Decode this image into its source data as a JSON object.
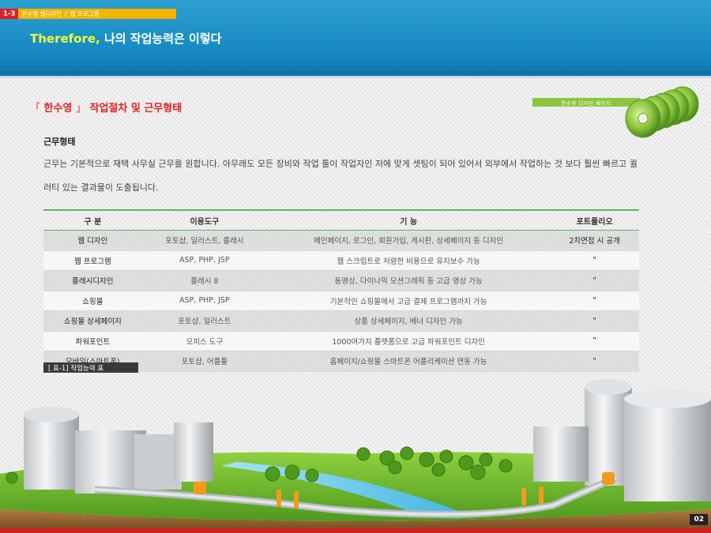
{
  "breadcrumb": {
    "section_no": "1-3",
    "items": [
      "한수영 웹디자인",
      "웹 프로그램"
    ],
    "separator": "/"
  },
  "header": {
    "lead": "Therefore,",
    "title": " 나의 작업능력은 이렇다"
  },
  "section": {
    "open_quote": "「",
    "name": " 한수영 ",
    "close_quote": "」",
    "title": " 작업절차 및 근무형태"
  },
  "badge": {
    "label": "한수영 디자인 페이지"
  },
  "work_type": {
    "heading": "근무형태",
    "body": "근무는 기본적으로 재택 사무실 근무를 원합니다. 아무래도 모든 장비와 작업 툴이 작업자인 저에 맞게 셋팅이 되어 있어서 외부에서 작업하는 것 보다 훨씬 빠르고 퀄러티 있는 결과물이 도출됩니다."
  },
  "table": {
    "headers": [
      "구  분",
      "이용도구",
      "기  능",
      "포트폴리오"
    ],
    "rows": [
      [
        "웹 디자인",
        "포토샵, 일러스트, 플래시",
        "메인페이지, 로그인, 회원가입, 게시판, 상세페이지 등 디자인",
        "2차면접 시 공개"
      ],
      [
        "웹 프로그램",
        "ASP, PHP, JSP",
        "웹 스크립트로 저렴한 비용으로 유지보수 가능",
        "\""
      ],
      [
        "플래시디자인",
        "플래시 8",
        "동영상, 다이나믹 모션그래픽 등 고급 영상 가능",
        "\""
      ],
      [
        "쇼핑몰",
        "ASP, PHP, JSP",
        "기본적인 쇼핑몰에서 고급 결제 프로그램까지 가능",
        "\""
      ],
      [
        "쇼핑몰 상세페이지",
        "포토샵, 일러스트",
        "상품 상세페이지, 베너 디자인 가능",
        "\""
      ],
      [
        "파워포인트",
        "오피스 도구",
        "1000여가지 플렛폼으로 고급 파워포인트 디자인",
        "\""
      ],
      [
        "모바일(스마트폰)",
        "포토샵, 어플툴",
        "홈페이지/쇼핑몰 스마트폰 어플리케이션 연동 가능",
        "\""
      ]
    ],
    "caption": "[ 표-1] 작업능력 표"
  },
  "page_number": "02",
  "colors": {
    "header_blue": "#1a8cc4",
    "accent_red": "#e0211f",
    "accent_yellow": "#f4b400",
    "accent_green": "#8cc63f",
    "table_rule": "#5cb85c"
  }
}
